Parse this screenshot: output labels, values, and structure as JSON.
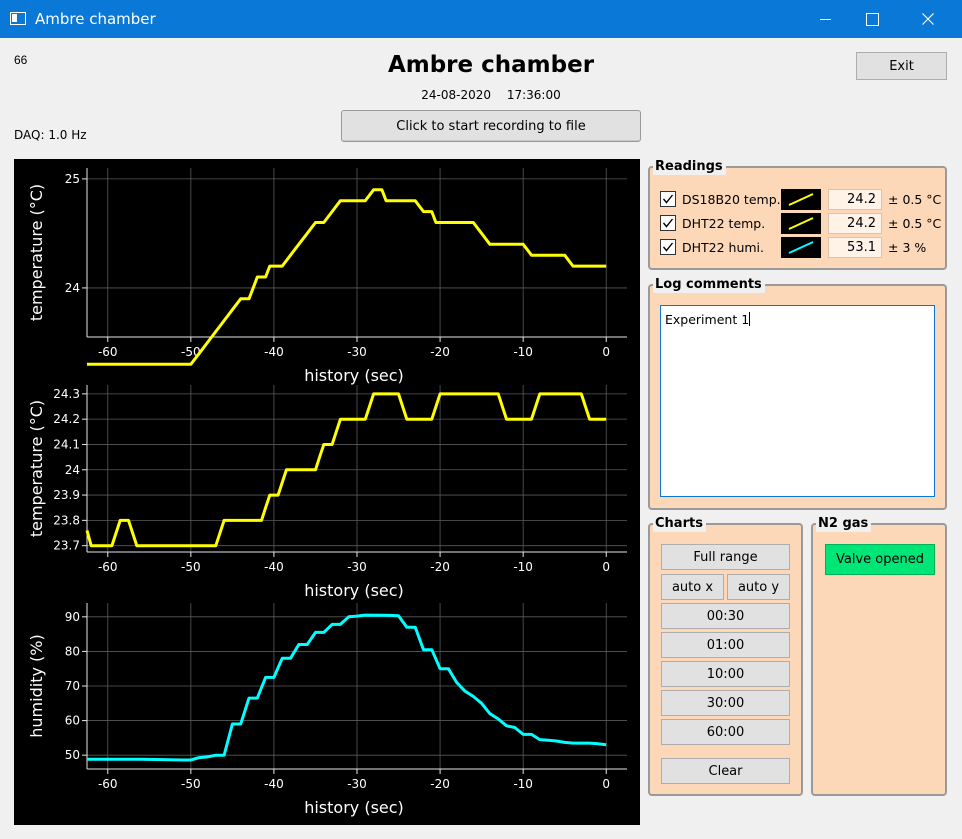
{
  "window": {
    "title": "Ambre chamber"
  },
  "header": {
    "counter": "66",
    "daq_rate": "DAQ: 1.0 Hz",
    "title": "Ambre chamber",
    "date": "24-08-2020",
    "time": "17:36:00",
    "record_button": "Click to start recording to file",
    "exit_button": "Exit"
  },
  "readings": {
    "title": "Readings",
    "items": [
      {
        "label": "DS18B20 temp.",
        "value": "24.2",
        "uncertainty": "± 0.5 °C",
        "color": "#ffff00",
        "checked": true
      },
      {
        "label": "DHT22 temp.",
        "value": "24.2",
        "uncertainty": "± 0.5 °C",
        "color": "#ffff00",
        "checked": true
      },
      {
        "label": "DHT22 humi.",
        "value": "53.1",
        "uncertainty": "± 3 %",
        "color": "#00ffff",
        "checked": true
      }
    ]
  },
  "log_comments": {
    "title": "Log comments",
    "text": "Experiment 1"
  },
  "charts_panel": {
    "title": "Charts",
    "full_range": "Full range",
    "auto_x": "auto x",
    "auto_y": "auto y",
    "ranges": [
      "00:30",
      "01:00",
      "10:00",
      "30:00",
      "60:00"
    ],
    "clear": "Clear"
  },
  "n2_panel": {
    "title": "N2 gas",
    "valve_status": "Valve opened",
    "valve_color": "#00e676"
  },
  "chart_data": [
    {
      "type": "line",
      "ylabel": "temperature (°C)",
      "xlabel": "history (sec)",
      "xlim": [
        -62.5,
        2.5
      ],
      "ylim": [
        23.55,
        25.1
      ],
      "xticks": [
        -60,
        -50,
        -40,
        -30,
        -20,
        -10,
        0
      ],
      "yticks": [
        24,
        25
      ],
      "grid": true,
      "series": [
        {
          "color": "#ffff00",
          "points": [
            [
              -62.5,
              23.3
            ],
            [
              -50,
              23.3
            ],
            [
              -49,
              23.4
            ],
            [
              -48,
              23.5
            ],
            [
              -47,
              23.6
            ],
            [
              -46,
              23.7
            ],
            [
              -45,
              23.8
            ],
            [
              -44,
              23.9
            ],
            [
              -43,
              23.9
            ],
            [
              -42.5,
              24.0
            ],
            [
              -42,
              24.1
            ],
            [
              -41,
              24.1
            ],
            [
              -40.5,
              24.2
            ],
            [
              -39,
              24.2
            ],
            [
              -38,
              24.3
            ],
            [
              -37,
              24.4
            ],
            [
              -36,
              24.5
            ],
            [
              -35,
              24.6
            ],
            [
              -34,
              24.6
            ],
            [
              -33,
              24.7
            ],
            [
              -32,
              24.8
            ],
            [
              -29,
              24.8
            ],
            [
              -28,
              24.9
            ],
            [
              -27,
              24.9
            ],
            [
              -26.5,
              24.8
            ],
            [
              -23,
              24.8
            ],
            [
              -22,
              24.7
            ],
            [
              -21,
              24.7
            ],
            [
              -20.5,
              24.6
            ],
            [
              -16,
              24.6
            ],
            [
              -15,
              24.5
            ],
            [
              -14,
              24.4
            ],
            [
              -10,
              24.4
            ],
            [
              -9,
              24.3
            ],
            [
              -5,
              24.3
            ],
            [
              -4,
              24.2
            ],
            [
              0,
              24.2
            ]
          ]
        }
      ]
    },
    {
      "type": "line",
      "ylabel": "temperature (°C)",
      "xlabel": "history (sec)",
      "xlim": [
        -62.5,
        2.5
      ],
      "ylim": [
        23.675,
        24.335
      ],
      "xticks": [
        -60,
        -50,
        -40,
        -30,
        -20,
        -10,
        0
      ],
      "yticks": [
        23.7,
        23.8,
        23.9,
        24,
        24.1,
        24.2,
        24.3
      ],
      "grid": true,
      "series": [
        {
          "color": "#ffff00",
          "points": [
            [
              -62.5,
              23.76
            ],
            [
              -62,
              23.7
            ],
            [
              -59.5,
              23.7
            ],
            [
              -58.5,
              23.8
            ],
            [
              -57.5,
              23.8
            ],
            [
              -56.5,
              23.7
            ],
            [
              -47,
              23.7
            ],
            [
              -46,
              23.8
            ],
            [
              -41.5,
              23.8
            ],
            [
              -41,
              23.85
            ],
            [
              -40.5,
              23.9
            ],
            [
              -39.5,
              23.9
            ],
            [
              -38.5,
              24.0
            ],
            [
              -35,
              24.0
            ],
            [
              -34.5,
              24.05
            ],
            [
              -34,
              24.1
            ],
            [
              -33,
              24.1
            ],
            [
              -32,
              24.2
            ],
            [
              -29,
              24.2
            ],
            [
              -28,
              24.3
            ],
            [
              -25,
              24.3
            ],
            [
              -24,
              24.2
            ],
            [
              -21,
              24.2
            ],
            [
              -20,
              24.3
            ],
            [
              -13,
              24.3
            ],
            [
              -12,
              24.2
            ],
            [
              -9,
              24.2
            ],
            [
              -8,
              24.3
            ],
            [
              -3,
              24.3
            ],
            [
              -2,
              24.2
            ],
            [
              0,
              24.2
            ]
          ]
        }
      ]
    },
    {
      "type": "line",
      "ylabel": "humidity (%)",
      "xlabel": "history (sec)",
      "xlim": [
        -62.5,
        2.5
      ],
      "ylim": [
        46,
        94
      ],
      "xticks": [
        -60,
        -50,
        -40,
        -30,
        -20,
        -10,
        0
      ],
      "yticks": [
        50,
        60,
        70,
        80,
        90
      ],
      "grid": true,
      "series": [
        {
          "color": "#00ffff",
          "points": [
            [
              -62.5,
              48.8
            ],
            [
              -56,
              48.8
            ],
            [
              -51,
              48.6
            ],
            [
              -50,
              48.6
            ],
            [
              -49,
              49.3
            ],
            [
              -48,
              49.5
            ],
            [
              -47,
              50
            ],
            [
              -46,
              50
            ],
            [
              -45,
              59
            ],
            [
              -44,
              59
            ],
            [
              -43,
              66.5
            ],
            [
              -42,
              66.5
            ],
            [
              -41,
              72.5
            ],
            [
              -40,
              72.5
            ],
            [
              -39,
              78
            ],
            [
              -38,
              78
            ],
            [
              -37,
              82
            ],
            [
              -36,
              82
            ],
            [
              -35,
              85.5
            ],
            [
              -34,
              85.5
            ],
            [
              -33,
              87.8
            ],
            [
              -32,
              87.8
            ],
            [
              -31,
              90
            ],
            [
              -30,
              90.2
            ],
            [
              -29,
              90.5
            ],
            [
              -26,
              90.4
            ],
            [
              -25,
              90.3
            ],
            [
              -24,
              87
            ],
            [
              -23,
              87
            ],
            [
              -22,
              80.5
            ],
            [
              -21,
              80.5
            ],
            [
              -20,
              75
            ],
            [
              -19,
              75
            ],
            [
              -18,
              71
            ],
            [
              -17,
              68.5
            ],
            [
              -16,
              67
            ],
            [
              -15,
              65
            ],
            [
              -14,
              62
            ],
            [
              -13,
              60.5
            ],
            [
              -12,
              58.5
            ],
            [
              -11,
              58
            ],
            [
              -10,
              56
            ],
            [
              -9,
              56
            ],
            [
              -8,
              54.5
            ],
            [
              -7,
              54.3
            ],
            [
              -6,
              54.1
            ],
            [
              -5,
              53.7
            ],
            [
              -4,
              53.5
            ],
            [
              -3,
              53.5
            ],
            [
              -2,
              53.5
            ],
            [
              -1,
              53.3
            ],
            [
              0,
              53
            ]
          ]
        }
      ]
    }
  ]
}
